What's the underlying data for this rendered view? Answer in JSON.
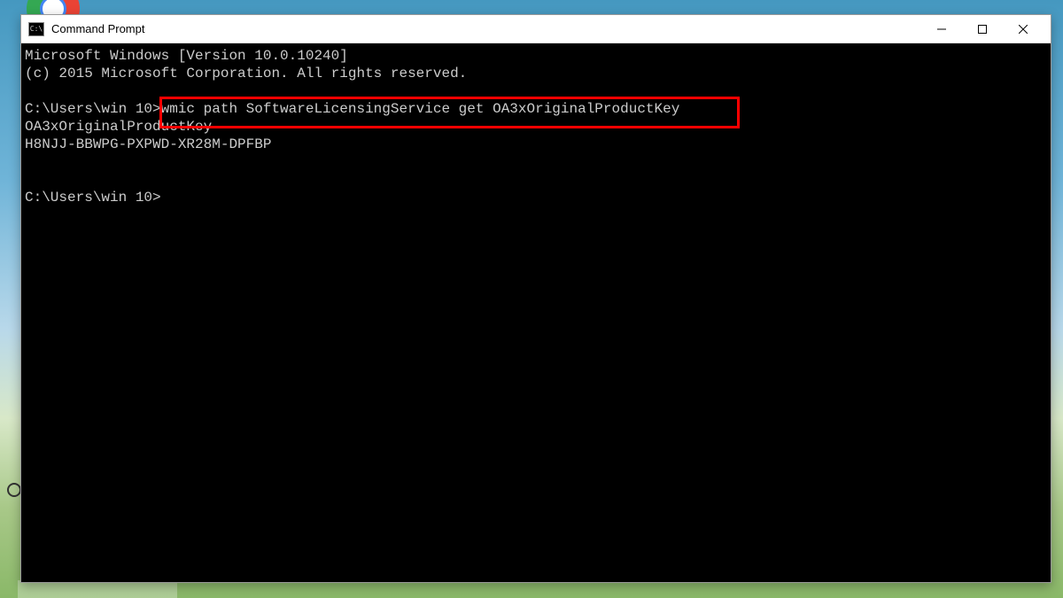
{
  "window": {
    "title": "Command Prompt",
    "icon_label": "C:\\"
  },
  "terminal": {
    "line1": "Microsoft Windows [Version 10.0.10240]",
    "line2": "(c) 2015 Microsoft Corporation. All rights reserved.",
    "blank1": "",
    "prompt1_path": "C:\\Users\\win 10>",
    "prompt1_cmd": "wmic path SoftwareLicensingService get OA3xOriginalProductKey",
    "output_header": "OA3xOriginalProductKey",
    "output_key": "H8NJJ-BBWPG-PXPWD-XR28M-DPFBP",
    "blank2": "",
    "blank3": "",
    "prompt2_path": "C:\\Users\\win 10>"
  }
}
